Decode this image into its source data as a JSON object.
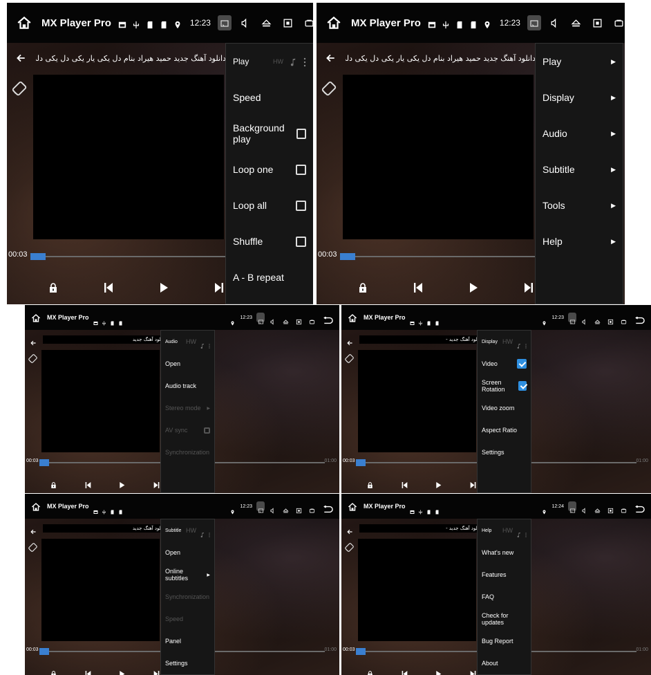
{
  "app_title": "MX Player Pro",
  "file_title_full": "دانلود آهنگ جدید حمید هیراد بنام دل یکی یار یکی دل یکی دلدار یکی",
  "file_title_short": "دانلود آهنگ جدید",
  "file_title_short_dash": "دانلود آهنگ جدید -",
  "current_time": "00:03",
  "end_time": "01:00",
  "hw_label": "HW",
  "colors": {
    "accent": "#3a7fd0",
    "checkbox_on": "#2e8fe0",
    "menu_bg": "#161616",
    "disabled": "#555555"
  },
  "panels": [
    {
      "id": "p1",
      "clock": "12:23",
      "title_variant": "full",
      "menu": {
        "title": "Play",
        "items": [
          {
            "label": "Speed"
          },
          {
            "label": "Background play",
            "checkbox": "off"
          },
          {
            "label": "Loop one",
            "checkbox": "off"
          },
          {
            "label": "Loop all",
            "checkbox": "off"
          },
          {
            "label": "Shuffle",
            "checkbox": "off"
          },
          {
            "label": "A - B repeat"
          }
        ]
      }
    },
    {
      "id": "p2",
      "clock": "12:23",
      "title_variant": "full",
      "menu": {
        "title": "",
        "items": [
          {
            "label": "Play",
            "arrow": true
          },
          {
            "label": "Display",
            "arrow": true
          },
          {
            "label": "Audio",
            "arrow": true
          },
          {
            "label": "Subtitle",
            "arrow": true
          },
          {
            "label": "Tools",
            "arrow": true
          },
          {
            "label": "Help",
            "arrow": true
          }
        ]
      }
    },
    {
      "id": "p3",
      "clock": "12:23",
      "title_variant": "short",
      "menu": {
        "title": "Audio",
        "items": [
          {
            "label": "Open"
          },
          {
            "label": "Audio track"
          },
          {
            "label": "Stereo mode",
            "arrow": true,
            "disabled": true
          },
          {
            "label": "AV sync",
            "checkbox": "off",
            "disabled": true
          },
          {
            "label": "Synchronization",
            "disabled": true
          }
        ]
      }
    },
    {
      "id": "p4",
      "clock": "12:23",
      "title_variant": "short_dash",
      "menu": {
        "title": "Display",
        "items": [
          {
            "label": "Video",
            "checkbox": "on"
          },
          {
            "label": "Screen Rotation",
            "checkbox": "on"
          },
          {
            "label": "Video zoom"
          },
          {
            "label": "Aspect Ratio"
          },
          {
            "label": "Settings"
          }
        ]
      }
    },
    {
      "id": "p5",
      "clock": "12:23",
      "title_variant": "short",
      "menu": {
        "title": "Subtitle",
        "items": [
          {
            "label": "Open"
          },
          {
            "label": "Online subtitles",
            "arrow": true
          },
          {
            "label": "Synchronization",
            "disabled": true
          },
          {
            "label": "Speed",
            "disabled": true
          },
          {
            "label": "Panel"
          },
          {
            "label": "Settings"
          }
        ]
      }
    },
    {
      "id": "p6",
      "clock": "12:24",
      "title_variant": "short_dash",
      "menu": {
        "title": "Help",
        "items": [
          {
            "label": "What's new"
          },
          {
            "label": "Features"
          },
          {
            "label": "FAQ"
          },
          {
            "label": "Check for updates"
          },
          {
            "label": "Bug Report"
          },
          {
            "label": "About"
          }
        ]
      }
    }
  ]
}
